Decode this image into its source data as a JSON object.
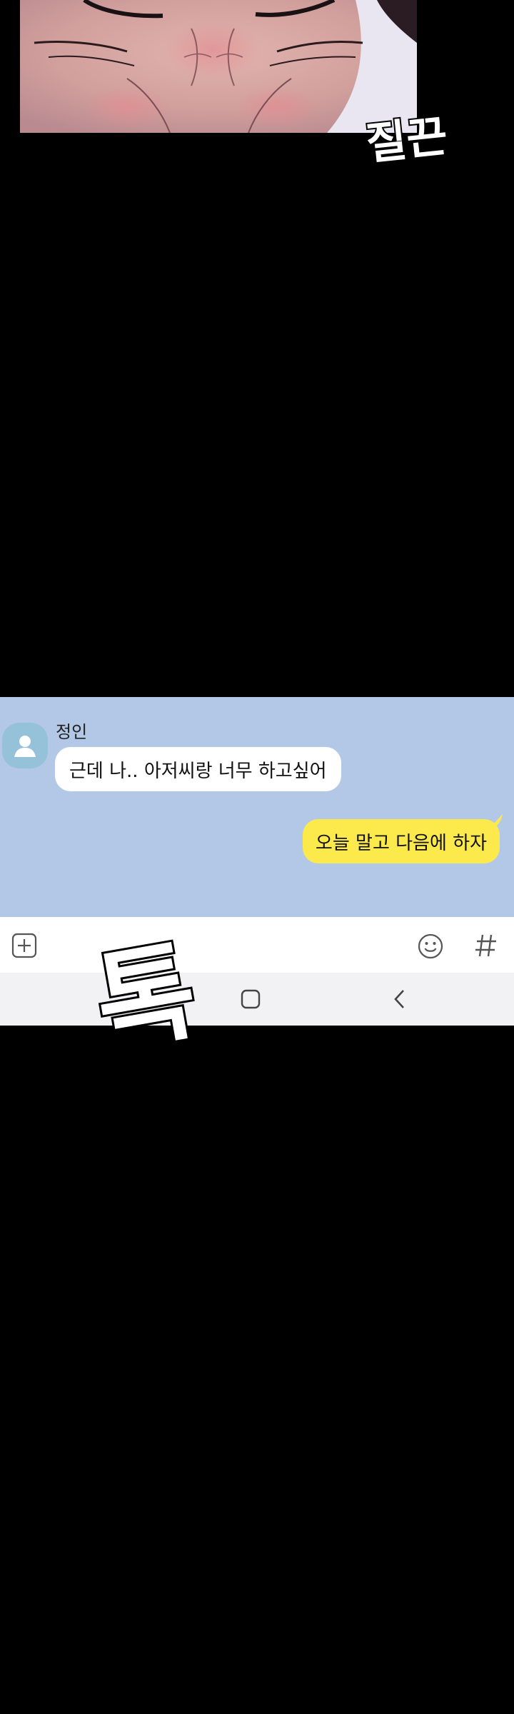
{
  "top_panel": {
    "sfx_text": "질끈"
  },
  "chat": {
    "contact_name": "정인",
    "incoming_message": "근데 나.. 아저씨랑 너무 하고싶어",
    "outgoing_message": "오늘 말고 다음에 하자",
    "input_bar": {
      "attach_icon": "plus-square-icon",
      "emoji_icon": "smiley-icon",
      "hashtag_icon": "hashtag-icon"
    },
    "nav_bar": {
      "home_icon": "square-home-icon",
      "back_icon": "chevron-left-icon"
    }
  },
  "sfx_overlay": {
    "text": "톡"
  },
  "colors": {
    "background": "#000000",
    "chat_background": "#b3c8e6",
    "incoming_bubble": "#ffffff",
    "outgoing_bubble": "#fcea4d",
    "avatar": "#95c2d9"
  }
}
